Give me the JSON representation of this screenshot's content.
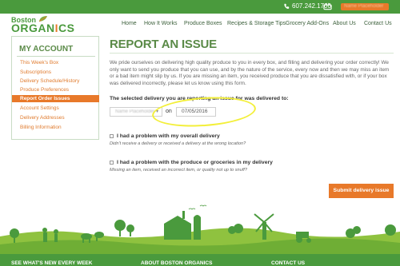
{
  "topbar": {
    "phone": "607.242.1700",
    "user_name": "Name Placeholder"
  },
  "logo": {
    "line1": "Boston",
    "line2_a": "ORGAN",
    "line2_b": "I",
    "line2_c": "CS"
  },
  "nav": [
    "Home",
    "How It Works",
    "Produce Boxes",
    "Recipes & Storage Tips",
    "Grocery Add-Ons",
    "About Us",
    "Contact Us"
  ],
  "sidebar": {
    "title": "MY ACCOUNT",
    "items": [
      {
        "label": "This Week's Box",
        "active": false
      },
      {
        "label": "Subscriptions",
        "active": false
      },
      {
        "label": "Delivery Schedule/History",
        "active": false
      },
      {
        "label": "Produce Preferences",
        "active": false
      },
      {
        "label": "Report Order Issues",
        "active": true
      },
      {
        "label": "Account Settings",
        "active": false
      },
      {
        "label": "Delivery Addresses",
        "active": false
      },
      {
        "label": "Billing Information",
        "active": false
      }
    ]
  },
  "main": {
    "title": "REPORT AN ISSUE",
    "intro": "We pride ourselves on delivering high quality produce to you in every box, and filling and delivering your order correctly! We only want to send you produce that you can use, and by the nature of the service, every now and then we may miss an item or a bad item might slip by us. If you are missing an item, you received produce that you are dissatisfied with, or if your box was delivered incorrectly, please let us know using this form.",
    "select_label": "The selected delivery you are reporting an issue for was delivered to:",
    "address_value": "Name Placeholder",
    "on_label": "on",
    "date_value": "07/05/2016",
    "option1": {
      "label": "I had a problem with my overall delivery",
      "sub": "Didn't receive a delivery or received a delivery at the wrong location?"
    },
    "option2": {
      "label": "I had a problem with the produce or groceries in my delivery",
      "sub": "Missing an item, received an incorrect item, or quality not up to snuff?"
    },
    "submit_label": "Submit delivery issue"
  },
  "footer": {
    "col1": "SEE WHAT'S NEW EVERY WEEK",
    "col2": "ABOUT BOSTON ORGANICS",
    "col3": "CONTACT US"
  },
  "colors": {
    "green": "#4a9a3d",
    "orange": "#e8792a",
    "highlight": "#f3ef3a"
  }
}
